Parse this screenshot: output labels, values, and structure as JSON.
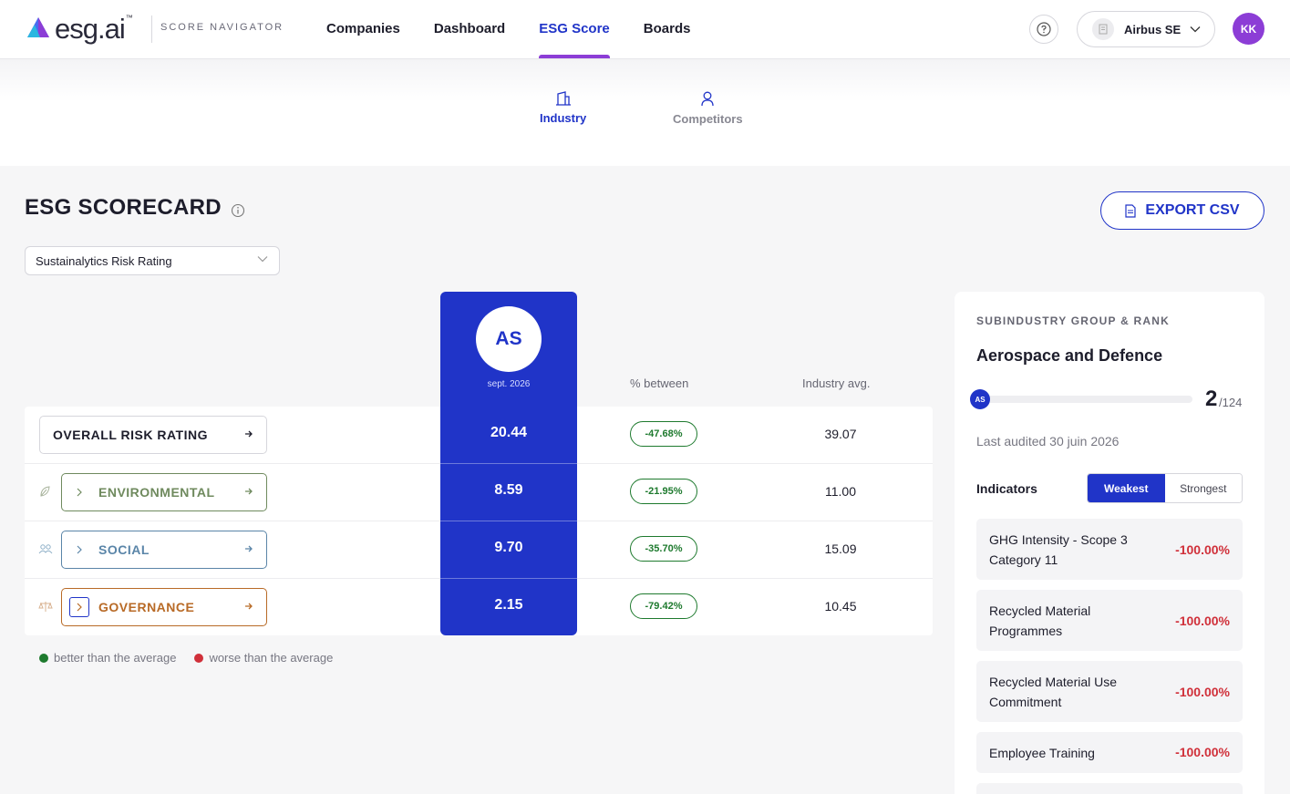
{
  "header": {
    "logo_text": "esg.ai",
    "logo_tm": "™",
    "product": "SCORE NAVIGATOR",
    "nav": [
      {
        "label": "Companies"
      },
      {
        "label": "Dashboard"
      },
      {
        "label": "ESG Score",
        "active": true
      },
      {
        "label": "Boards"
      }
    ],
    "company": "Airbus SE",
    "avatar": "KK"
  },
  "subtabs": [
    {
      "label": "Industry",
      "icon": "building-icon",
      "active": true
    },
    {
      "label": "Competitors",
      "icon": "person-icon"
    }
  ],
  "page": {
    "title": "ESG SCORECARD",
    "export_label": "EXPORT CSV",
    "rating_select": "Sustainalytics Risk Rating"
  },
  "scorecard": {
    "company_initials": "AS",
    "date": "sept. 2026",
    "col_pct": "% between",
    "col_avg": "Industry avg.",
    "rows": [
      {
        "label": "OVERALL RISK RATING",
        "score": "20.44",
        "pct": "-47.68%",
        "avg": "39.07"
      },
      {
        "label": "ENVIRONMENTAL",
        "score": "8.59",
        "pct": "-21.95%",
        "avg": "11.00",
        "icon": "leaf-icon"
      },
      {
        "label": "SOCIAL",
        "score": "9.70",
        "pct": "-35.70%",
        "avg": "15.09",
        "icon": "people-icon"
      },
      {
        "label": "GOVERNANCE",
        "score": "2.15",
        "pct": "-79.42%",
        "avg": "10.45",
        "icon": "scales-icon"
      }
    ],
    "legend": {
      "better": "better than the average",
      "worse": "worse than the average"
    }
  },
  "colors": {
    "accent": "#2034c8",
    "purple": "#8c3dd6",
    "better": "#1e7a2e",
    "worse": "#d0303a",
    "env": "#6f8a5e",
    "social": "#5a85a8",
    "gov": "#b86a26"
  },
  "panel": {
    "label": "SUBINDUSTRY GROUP & RANK",
    "title": "Aerospace and Defence",
    "rank_initials": "AS",
    "rank": "2",
    "rank_total": "/124",
    "audited": "Last audited 30 juin 2026",
    "indicators_label": "Indicators",
    "toggle": {
      "weakest": "Weakest",
      "strongest": "Strongest"
    },
    "indicators": [
      {
        "name": "GHG Intensity - Scope 3 Category 11",
        "value": "-100.00%"
      },
      {
        "name": "Recycled Material Programmes",
        "value": "-100.00%"
      },
      {
        "name": "Recycled Material Use Commitment",
        "value": "-100.00%"
      },
      {
        "name": "Employee Training",
        "value": "-100.00%"
      }
    ]
  }
}
